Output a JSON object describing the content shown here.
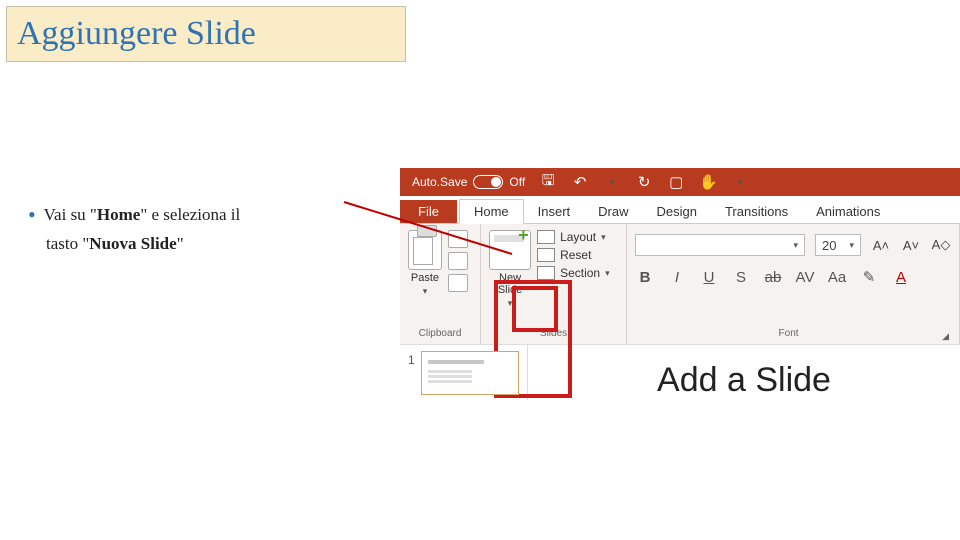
{
  "slide": {
    "title": "Aggiungere Slide",
    "bullet_prefix": "Vai su \"",
    "bullet_home": "Home",
    "bullet_mid": "\" e seleziona il",
    "bullet_line2_prefix": "tasto   \"",
    "bullet_nuova": "Nuova Slide",
    "bullet_line2_suffix": "\""
  },
  "titlebar": {
    "autosave_label": "Auto.Save",
    "autosave_state": "Off",
    "icons": {
      "save": "🖫",
      "undo": "↶",
      "redo": "↻",
      "slideshow": "▢",
      "touch": "✋"
    }
  },
  "tabs": {
    "file": "File",
    "home": "Home",
    "insert": "Insert",
    "draw": "Draw",
    "design": "Design",
    "transitions": "Transitions",
    "animations": "Animations"
  },
  "ribbon": {
    "clipboard": {
      "label": "Clipboard",
      "paste": "Paste"
    },
    "slides": {
      "label": "Slides",
      "new_slide": "New\nSlide",
      "layout": "Layout",
      "reset": "Reset",
      "section": "Section"
    },
    "font": {
      "label": "Font",
      "size": "20",
      "bold": "B",
      "italic": "I",
      "underline": "U",
      "shadow": "S",
      "strike": "ab",
      "spacing": "AV",
      "case": "Aa",
      "grow": "A˄",
      "shrink": "A˅",
      "clear": "A◇",
      "highlight_icon": "✎",
      "color_icon": "A"
    }
  },
  "deck": {
    "thumb_number": "1",
    "canvas_text": "Add a Slide"
  }
}
